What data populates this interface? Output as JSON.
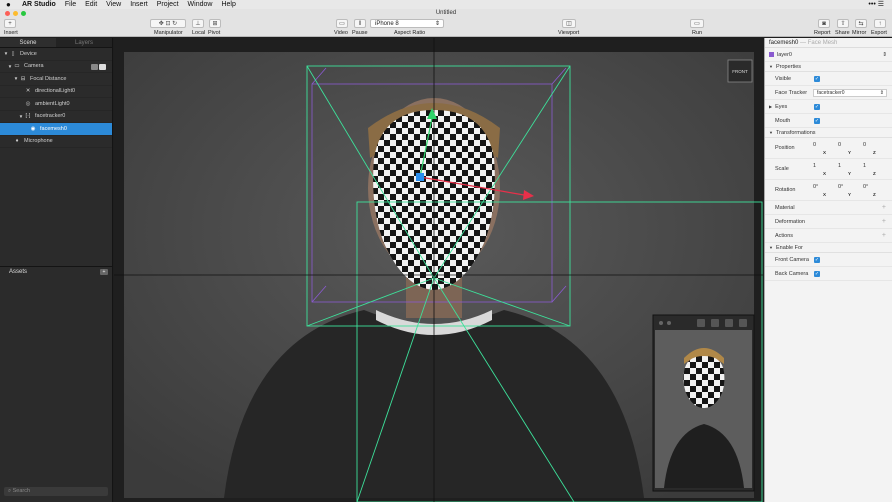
{
  "menu": {
    "app": "AR Studio",
    "items": [
      "File",
      "Edit",
      "View",
      "Insert",
      "Project",
      "Window",
      "Help"
    ],
    "right": "••• ☰"
  },
  "window": {
    "title": "Untitled"
  },
  "toolbar": {
    "insert": "Insert",
    "manipulator": "Manipulator",
    "local": "Local",
    "pivot": "Pivot",
    "video": "Video",
    "pause": "Pause",
    "device": "iPhone 8",
    "aspect_ratio": "Aspect Ratio",
    "viewport": "Viewport",
    "run": "Run",
    "report": "Report",
    "share": "Share",
    "mirror": "Mirror",
    "export": "Export"
  },
  "left": {
    "tabs": [
      "Scene",
      "Layers"
    ],
    "tree": [
      {
        "label": "Device",
        "icon": "device-icon"
      },
      {
        "label": "Camera",
        "icon": "camera-icon"
      },
      {
        "label": "Focal Distance",
        "icon": "focal-icon"
      },
      {
        "label": "directionalLight0",
        "icon": "directional-light-icon"
      },
      {
        "label": "ambientLight0",
        "icon": "ambient-light-icon"
      },
      {
        "label": "facetracker0",
        "icon": "facetracker-icon"
      },
      {
        "label": "facemesh0",
        "icon": "facemesh-icon"
      },
      {
        "label": "Microphone",
        "icon": "microphone-icon"
      }
    ],
    "assets": "Assets",
    "search": "Search"
  },
  "viewport": {
    "front_label": "FRONT"
  },
  "right": {
    "title": "facemesh0",
    "subtitle": "— Face Mesh",
    "layer": "layer0",
    "properties": "Properties",
    "visible": "Visible",
    "face_tracker": "Face Tracker",
    "face_tracker_value": "facetracker0",
    "eyes": "Eyes",
    "mouth": "Mouth",
    "transformations": "Transformations",
    "position": "Position",
    "position_vals": [
      "0",
      "0",
      "0"
    ],
    "scale": "Scale",
    "scale_vals": [
      "1",
      "1",
      "1"
    ],
    "rotation": "Rotation",
    "rotation_vals": [
      "0°",
      "0°",
      "0°"
    ],
    "axes": [
      "X",
      "Y",
      "Z"
    ],
    "material": "Material",
    "deformation": "Deformation",
    "actions": "Actions",
    "enable_for": "Enable For",
    "front_camera": "Front Camera",
    "back_camera": "Back Camera"
  },
  "colors": {
    "accent": "#2c8ad8",
    "frustum": "#3de09a",
    "gizmo_red": "#e8304a",
    "gizmo_green": "#2fd46b",
    "gizmo_blue": "#2a8ff0"
  }
}
